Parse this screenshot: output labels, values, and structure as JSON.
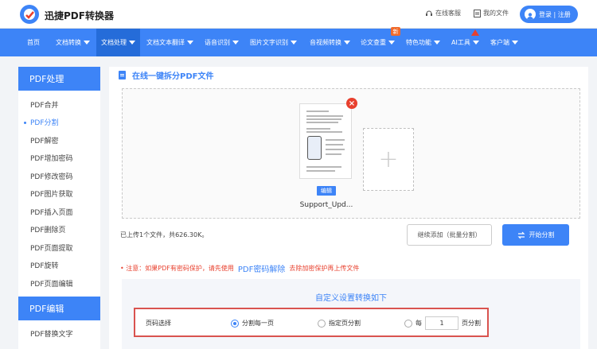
{
  "header": {
    "brand": "迅捷PDF转换器",
    "service": "在线客服",
    "my_files": "我的文件",
    "login": "登录 | 注册"
  },
  "nav": {
    "items": [
      "首页",
      "文档转换",
      "文档处理",
      "文档文本翻译",
      "语音识别",
      "图片文字识别",
      "音视频转换",
      "论文查重",
      "特色功能",
      "AI工具",
      "客户端"
    ],
    "new_badge": "新"
  },
  "sidebar": {
    "heading": "PDF处理",
    "items": [
      "PDF合并",
      "PDF分割",
      "PDF解密",
      "PDF增加密码",
      "PDF修改密码",
      "PDF图片获取",
      "PDF插入页面",
      "PDF删除页",
      "PDF页面提取",
      "PDF旋转",
      "PDF页面编辑"
    ],
    "heading2": "PDF编辑",
    "items2": [
      "PDF替换文字"
    ]
  },
  "main": {
    "title": "在线一键拆分PDF文件",
    "file_name": "Support_Upd...",
    "edit_tag": "编辑",
    "upload_count": "已上传1个文件，共626.30K。",
    "continue_add": "继续添加（批量分割）",
    "start_split": "开始分割",
    "notice_pre": "• 注意：如果PDF有密码保护，请先使用",
    "notice_link": "PDF密码解除",
    "notice_post": "去除加密保护再上传文件",
    "settings_title": "自定义设置转换如下",
    "page_select_label": "页码选择",
    "opt_every_page": "分割每一页",
    "opt_specified": "指定页分割",
    "opt_every_prefix": "每",
    "opt_every_value": "1",
    "opt_every_suffix": "页分割"
  },
  "colors": {
    "accent": "#3d84f7",
    "alert": "#e8402e"
  }
}
